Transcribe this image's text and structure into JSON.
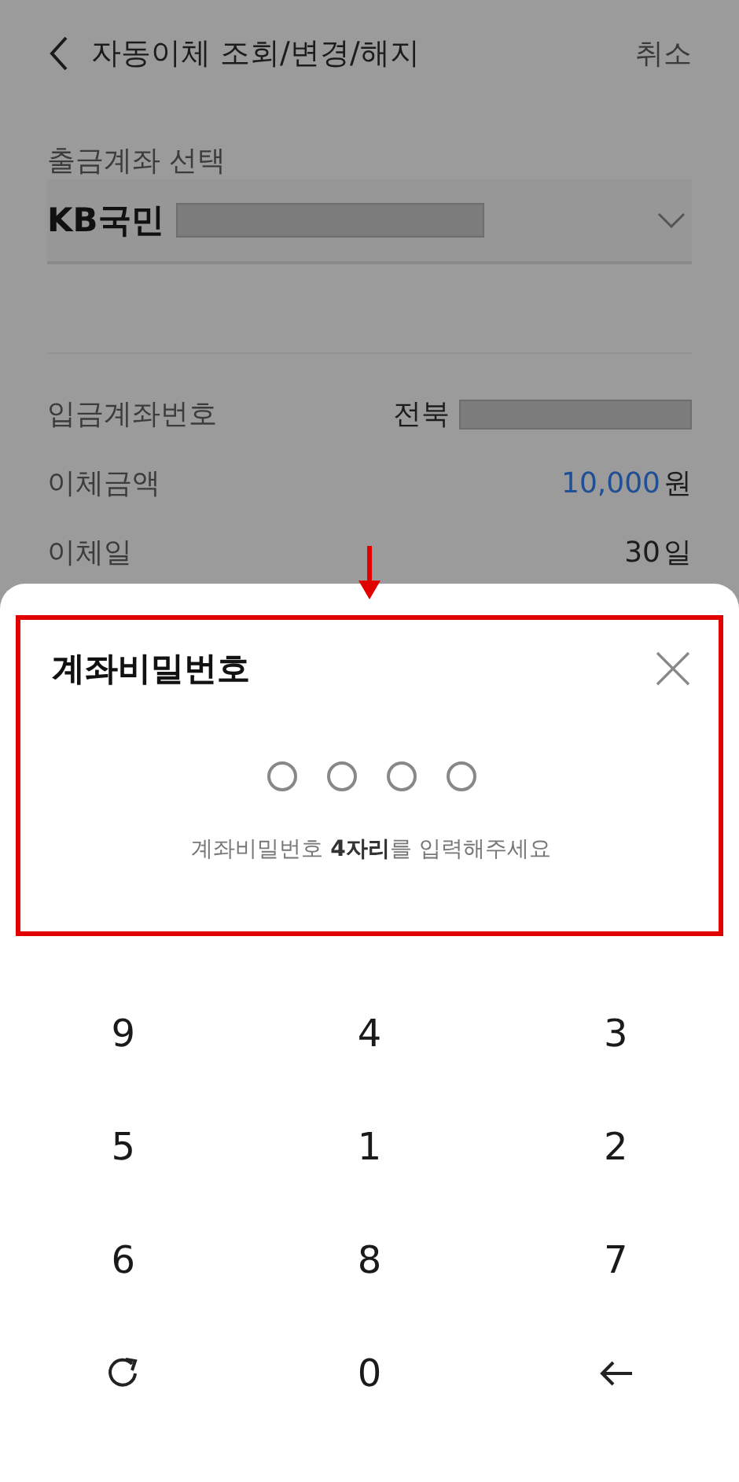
{
  "header": {
    "title": "자동이체 조회/변경/해지",
    "cancel": "취소"
  },
  "withdraw_account": {
    "label": "출금계좌 선택",
    "bank": "KB국민"
  },
  "details": [
    {
      "label": "입금계좌번호",
      "value": "전북",
      "kind": "account"
    },
    {
      "label": "이체금액",
      "value": "10,000",
      "unit": "원",
      "kind": "amount"
    },
    {
      "label": "이체일",
      "value": "30",
      "unit": "일",
      "kind": "plain"
    }
  ],
  "sheet": {
    "title": "계좌비밀번호",
    "pin_dots": [
      {
        "filled": false
      },
      {
        "filled": false
      },
      {
        "filled": false
      },
      {
        "filled": false
      }
    ],
    "hint": "계좌비밀번호 **4자리**를 입력해주세요"
  },
  "keypad": [
    {
      "kind": "digit",
      "label": "9"
    },
    {
      "kind": "digit",
      "label": "4"
    },
    {
      "kind": "digit",
      "label": "3"
    },
    {
      "kind": "digit",
      "label": "5"
    },
    {
      "kind": "digit",
      "label": "1"
    },
    {
      "kind": "digit",
      "label": "2"
    },
    {
      "kind": "digit",
      "label": "6"
    },
    {
      "kind": "digit",
      "label": "8"
    },
    {
      "kind": "digit",
      "label": "7"
    },
    {
      "kind": "refresh"
    },
    {
      "kind": "digit",
      "label": "0"
    },
    {
      "kind": "backspace"
    }
  ]
}
